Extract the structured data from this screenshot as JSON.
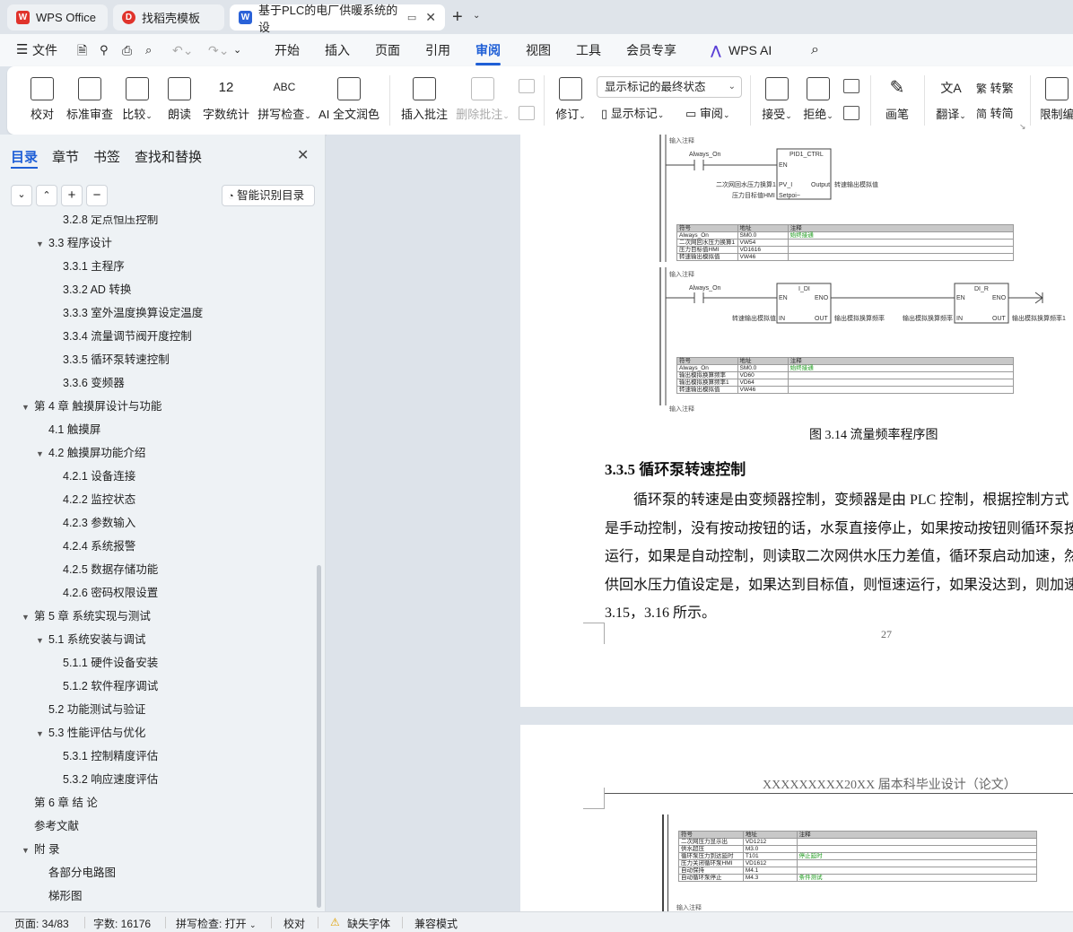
{
  "tabs": [
    {
      "label": "WPS Office"
    },
    {
      "label": "找稻壳模板"
    },
    {
      "label": "基于PLC的电厂供暖系统的设"
    }
  ],
  "menu": {
    "file": "文件",
    "items": [
      "开始",
      "插入",
      "页面",
      "引用",
      "审阅",
      "视图",
      "工具",
      "会员专享"
    ],
    "active": "审阅",
    "ai": "WPS AI"
  },
  "toolbar": {
    "proofread": "校对",
    "standard_review": "标准审查",
    "compare": "比较",
    "read_aloud": "朗读",
    "word_count": "字数统计",
    "spell_check": "拼写检查",
    "ai_polish": "AI 全文润色",
    "insert_comment": "插入批注",
    "delete_comment": "删除批注",
    "revise": "修订",
    "markup_select": "显示标记的最终状态",
    "show_markup": "显示标记",
    "review": "审阅",
    "accept": "接受",
    "reject": "拒绝",
    "pen": "画笔",
    "translate": "翻译",
    "to_traditional": "转繁",
    "to_simplified": "转简",
    "restrict_edit": "限制编"
  },
  "panel": {
    "tabs": [
      "目录",
      "章节",
      "书签",
      "查找和替换"
    ],
    "smart_btn": "智能识别目录",
    "toc": [
      {
        "text": "3.2.8  定点恒压控制",
        "level": 3
      },
      {
        "text": "3.3  程序设计",
        "level": 2,
        "expand": true
      },
      {
        "text": "3.3.1  主程序",
        "level": 3
      },
      {
        "text": "3.3.2 AD 转换",
        "level": 3
      },
      {
        "text": "3.3.3  室外温度换算设定温度",
        "level": 3
      },
      {
        "text": "3.3.4  流量调节阀开度控制",
        "level": 3
      },
      {
        "text": "3.3.5  循环泵转速控制",
        "level": 3
      },
      {
        "text": "3.3.6  变频器",
        "level": 3
      },
      {
        "text": "第 4 章    触摸屏设计与功能",
        "level": 1,
        "expand": true
      },
      {
        "text": "4.1  触摸屏",
        "level": 2
      },
      {
        "text": "4.2  触摸屏功能介绍",
        "level": 2,
        "expand": true
      },
      {
        "text": "4.2.1  设备连接",
        "level": 3
      },
      {
        "text": "4.2.2  监控状态",
        "level": 3
      },
      {
        "text": "4.2.3  参数输入",
        "level": 3
      },
      {
        "text": "4.2.4  系统报警",
        "level": 3
      },
      {
        "text": "4.2.5  数据存储功能",
        "level": 3
      },
      {
        "text": "4.2.6  密码权限设置",
        "level": 3
      },
      {
        "text": "第 5 章    系统实现与测试",
        "level": 1,
        "expand": true
      },
      {
        "text": "5.1  系统安装与调试",
        "level": 2,
        "expand": true
      },
      {
        "text": "5.1.1  硬件设备安装",
        "level": 3
      },
      {
        "text": "5.1.2  软件程序调试",
        "level": 3
      },
      {
        "text": "5.2  功能测试与验证",
        "level": 2
      },
      {
        "text": "5.3 性能评估与优化",
        "level": 2,
        "expand": true
      },
      {
        "text": "5.3.1  控制精度评估",
        "level": 3
      },
      {
        "text": "5.3.2  响应速度评估",
        "level": 3
      },
      {
        "text": "第 6 章    结    论",
        "level": 1
      },
      {
        "text": "参考文献",
        "level": 1
      },
      {
        "text": "附    录",
        "level": 1,
        "expand": true
      },
      {
        "text": "各部分电路图",
        "level": 2
      },
      {
        "text": "梯形图",
        "level": 2
      }
    ]
  },
  "doc": {
    "net_comment": "输入注释",
    "always_on": "Always_On",
    "pid_block": "PID1_CTRL",
    "en": "EN",
    "eno": "ENO",
    "pv": "PV_I",
    "setpoint": "Setpoi~",
    "output": "Output",
    "in": "IN",
    "out": "OUT",
    "pid_in1": "二次网回水压力换算1",
    "pid_in2": "压力目标值HMI",
    "pid_out": "转速输出模拟值",
    "idi_block": "I_DI",
    "dir_block": "DI_R",
    "idi_in": "转速输出模拟值",
    "idi_out": "输出模拟换算频率",
    "dir_in": "输出模拟换算频率",
    "dir_out": "输出模拟换算频率1",
    "table_headers": [
      "符号",
      "地址",
      "注释"
    ],
    "table1": [
      [
        "Always_On",
        "SM0.0",
        "始终接通"
      ],
      [
        "二次网回水压力换算1",
        "VW54",
        ""
      ],
      [
        "压力目标值HMI",
        "VD1616",
        ""
      ],
      [
        "转速输出模拟值",
        "VW46",
        ""
      ]
    ],
    "table2": [
      [
        "Always_On",
        "SM0.0",
        "始终接通"
      ],
      [
        "输出模拟换算频率",
        "VD60",
        ""
      ],
      [
        "输出模拟换算频率1",
        "VD64",
        ""
      ],
      [
        "转速输出模拟值",
        "VW46",
        ""
      ]
    ],
    "table3": [
      [
        "二次网压力显示出",
        "VD1212",
        ""
      ],
      [
        "供水超压",
        "M3.0",
        ""
      ],
      [
        "循环泵压力到达延时",
        "T101",
        "停止延时"
      ],
      [
        "压力关闭循环泵HMI",
        "VD1612",
        ""
      ],
      [
        "自动保持",
        "M4.1",
        ""
      ],
      [
        "自动循环泵停止",
        "M4.3",
        "条件测试"
      ]
    ],
    "figure_caption": "图 3.14  流量频率程序图",
    "section_title": "3.3.5  循环泵转速控制",
    "paragraph_lines": [
      "循环泵的转速是由变频器控制，变频器是由 PLC 控制，根据控制方式",
      "是手动控制，没有按动按钮的话，水泵直接停止，如果按动按钮则循环泵按",
      "运行，如果是自动控制，则读取二次网供水压力差值，循环泵启动加速，然",
      "供回水压力值设定是，如果达到目标值，则恒速运行，如果没达到，则加速",
      "3.15，3.16 所示。"
    ],
    "page_number": "27",
    "header_text": "XXXXXXXXX20XX 届本科毕业设计（论文）"
  },
  "status": {
    "page": "页面: 34/83",
    "words": "字数: 16176",
    "spell": "拼写检查: 打开",
    "proof": "校对",
    "missing_font": "缺失字体",
    "compat": "兼容模式"
  },
  "colors": {
    "accent": "#1f5fd6",
    "wps_red": "#e0332b",
    "green_note": "#1a9a1a"
  }
}
